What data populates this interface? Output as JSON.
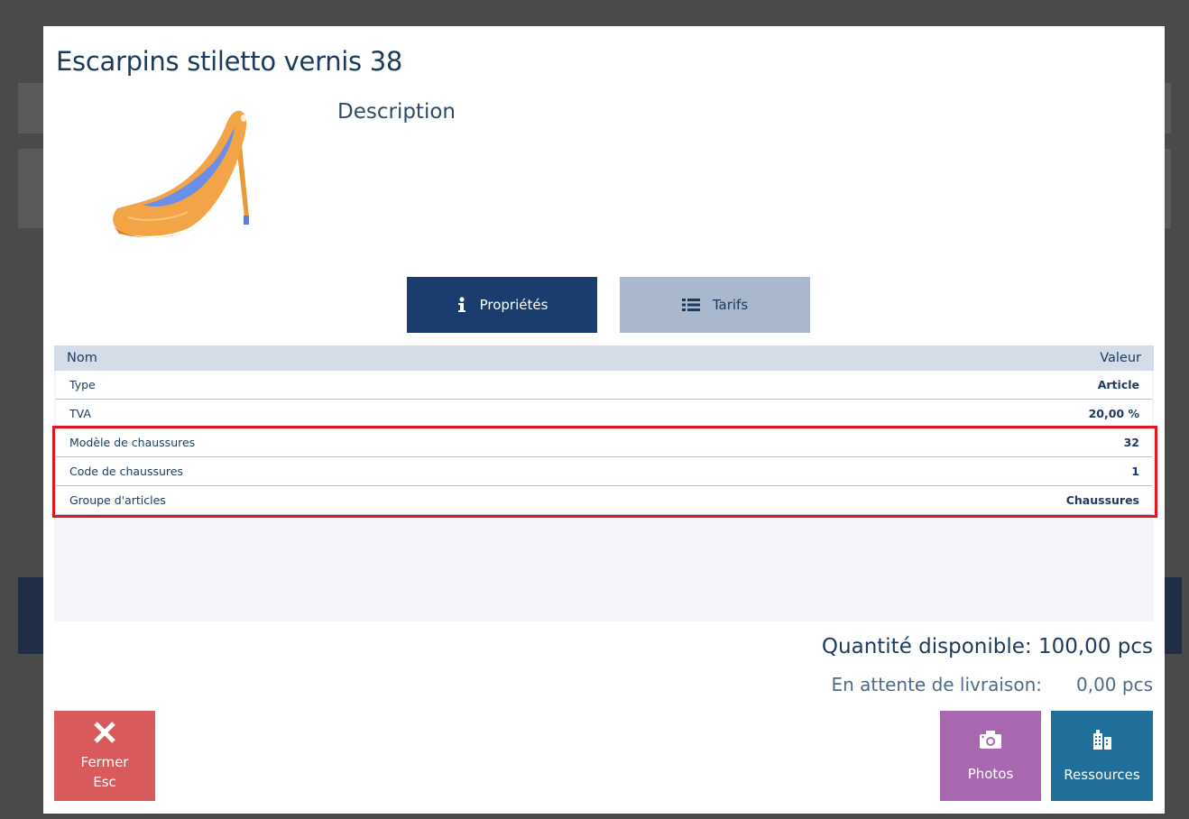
{
  "product": {
    "title": "Escarpins stiletto vernis 38",
    "description_heading": "Description",
    "image_icon": "high-heel-shoe-image"
  },
  "tabs": [
    {
      "label": "Propriétés",
      "icon": "info-icon",
      "active": true
    },
    {
      "label": "Tarifs",
      "icon": "list-icon",
      "active": false
    }
  ],
  "properties": {
    "header": {
      "name": "Nom",
      "value": "Valeur"
    },
    "rows": [
      {
        "name": "Type",
        "value": "Article"
      },
      {
        "name": "TVA",
        "value": "20,00 %"
      },
      {
        "name": "Modèle de chaussures",
        "value": "32"
      },
      {
        "name": "Code de chaussures",
        "value": "1"
      },
      {
        "name": "Groupe d'articles",
        "value": "Chaussures"
      }
    ]
  },
  "quantity": {
    "available": "Quantité disponible: 100,00 pcs",
    "pending_label": "En attente de livraison:",
    "pending_value": "0,00 pcs"
  },
  "buttons": {
    "close_line1": "Fermer",
    "close_line2": "Esc",
    "photos": "Photos",
    "resources": "Ressources"
  },
  "colors": {
    "accent": "#1b3d6e",
    "tab_inactive": "#a9b8cc",
    "close": "#d85a5a",
    "photos": "#a868b0",
    "resources": "#1f6f9a",
    "highlight": "#e3151d"
  }
}
